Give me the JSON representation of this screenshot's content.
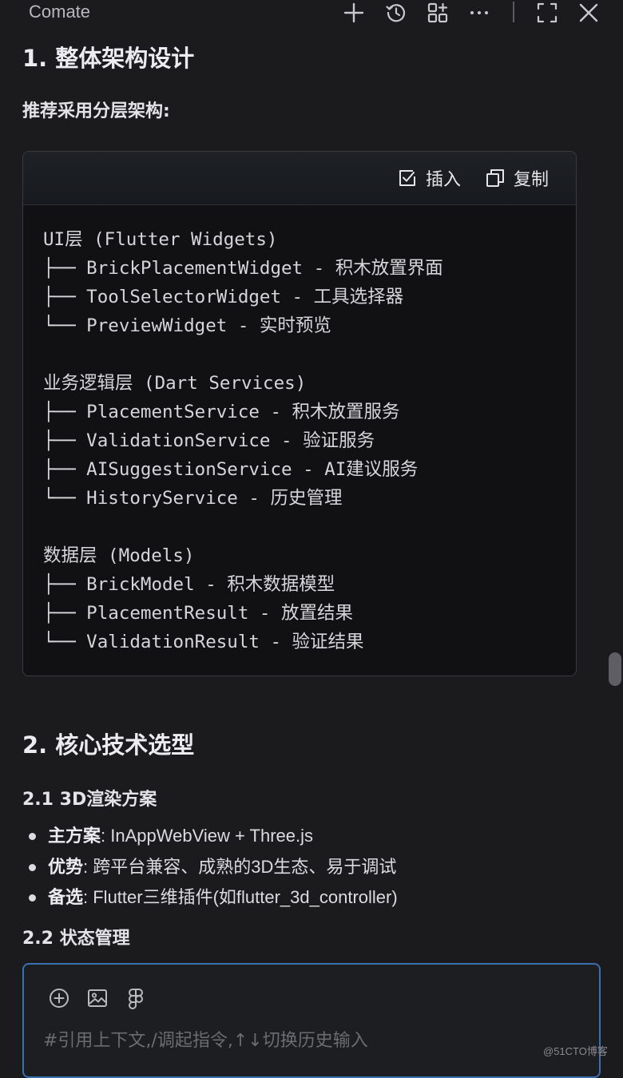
{
  "app": {
    "title": "Comate"
  },
  "toolbar": {
    "icons": [
      "plus-icon",
      "history-icon",
      "grid-plus-icon",
      "more-icon",
      "expand-icon",
      "close-icon"
    ]
  },
  "content": {
    "section1_title": "1. 整体架构设计",
    "lead": "推荐采用分层架构:",
    "code_block": {
      "insert_label": "插入",
      "copy_label": "复制",
      "code": "UI层 (Flutter Widgets)\n├── BrickPlacementWidget - 积木放置界面\n├── ToolSelectorWidget - 工具选择器\n└── PreviewWidget - 实时预览\n\n业务逻辑层 (Dart Services)\n├── PlacementService - 积木放置服务\n├── ValidationService - 验证服务\n├── AISuggestionService - AI建议服务\n└── HistoryService - 历史管理\n\n数据层 (Models)\n├── BrickModel - 积木数据模型\n├── PlacementResult - 放置结果\n└── ValidationResult - 验证结果"
    },
    "section2_title": "2. 核心技术选型",
    "sub21_title": "2.1 3D渲染方案",
    "bullets": [
      {
        "key": "主方案",
        "text": ": InAppWebView + Three.js"
      },
      {
        "key": "优势",
        "text": ": 跨平台兼容、成熟的3D生态、易于调试"
      },
      {
        "key": "备选",
        "text": ": Flutter三维插件(如flutter_3d_controller)"
      }
    ],
    "sub22_title": "2.2 状态管理"
  },
  "composer": {
    "placeholder": "#引用上下文,/调起指令,↑↓切换历史输入",
    "value": ""
  },
  "watermark": "@51CTO博客"
}
